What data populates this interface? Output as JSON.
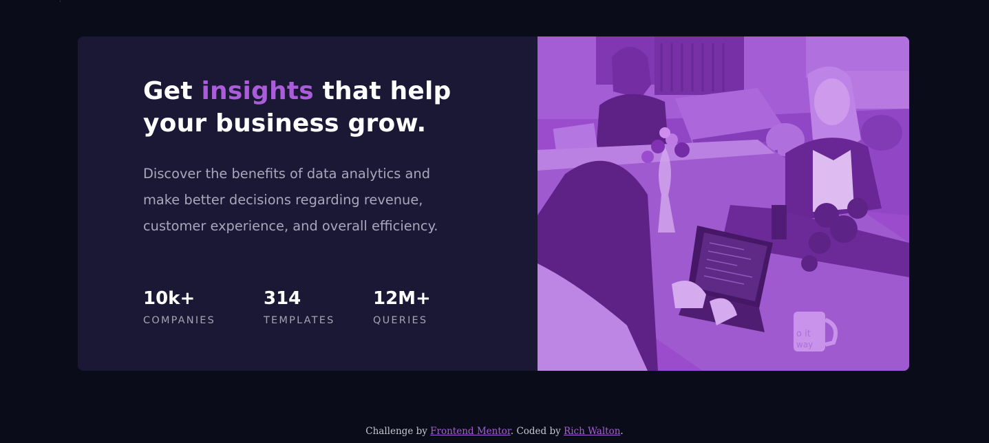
{
  "hero": {
    "headline_before": "Get ",
    "headline_accent": "insights",
    "headline_after": " that help your business grow.",
    "description": "Discover the benefits of data analytics and make better decisions regarding revenue, customer experience, and overall efficiency.",
    "stats": [
      {
        "value": "10k+",
        "label": "COMPANIES"
      },
      {
        "value": "314",
        "label": "TEMPLATES"
      },
      {
        "value": "12M+",
        "label": "QUERIES"
      }
    ],
    "image": {
      "icon": "office-meeting-photo",
      "mug_text_line1": "o it",
      "mug_text_line2": "way"
    }
  },
  "footer": {
    "prefix": "Challenge by ",
    "link1": "Frontend Mentor",
    "middle": ". Coded by ",
    "link2": "Rich Walton",
    "suffix": "."
  },
  "colors": {
    "background": "#0a0c19",
    "card": "#1b1835",
    "accent": "#aa5cdb",
    "image_overlay": "#9a4fcb",
    "text_primary": "#ffffff",
    "text_muted": "#a9a6bd"
  }
}
